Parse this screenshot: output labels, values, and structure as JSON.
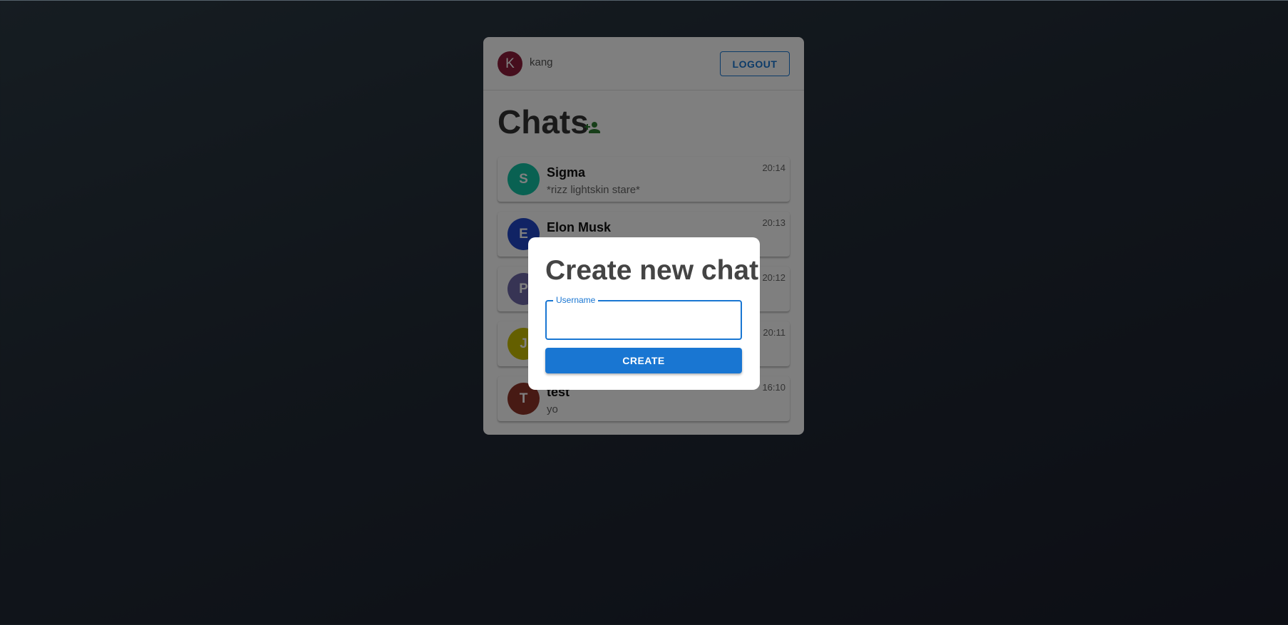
{
  "user": {
    "initial": "K",
    "name": "kang",
    "avatar_color": "#8c1d3b"
  },
  "header": {
    "logout_label": "LOGOUT"
  },
  "chats": {
    "title": "Chats",
    "add_icon": "person-add-icon",
    "items": [
      {
        "initial": "S",
        "name": "Sigma",
        "message": "*rizz lightskin stare*",
        "time": "20:14",
        "color": "#12c3a4"
      },
      {
        "initial": "E",
        "name": "Elon Musk",
        "message": "",
        "time": "20:13",
        "color": "#2147c9"
      },
      {
        "initial": "P",
        "name": "",
        "message": "",
        "time": "20:12",
        "color": "#6f69a8"
      },
      {
        "initial": "J",
        "name": "",
        "message": "",
        "time": "20:11",
        "color": "#c8bf00"
      },
      {
        "initial": "T",
        "name": "test",
        "message": "yo",
        "time": "16:10",
        "color": "#8f3528"
      }
    ]
  },
  "modal": {
    "title": "Create new chat",
    "username_label": "Username",
    "username_value": "",
    "create_label": "CREATE"
  },
  "colors": {
    "primary": "#1976d2",
    "add_icon": "#2e7d32",
    "backdrop": "rgba(0,0,0,0.5)"
  }
}
